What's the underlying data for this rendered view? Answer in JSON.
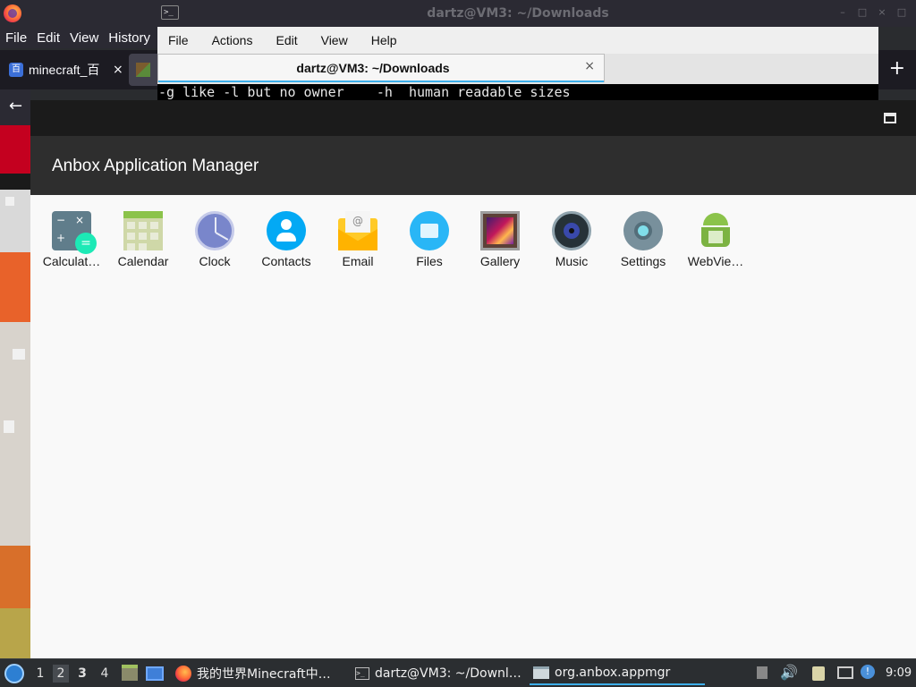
{
  "firefox": {
    "menu": [
      "File",
      "Edit",
      "View",
      "History"
    ],
    "tab1_label": "minecraft_百",
    "tab1_close": "×",
    "new_tab": "+",
    "back": "←",
    "tab1_favicon": "百"
  },
  "terminal": {
    "window_title": "dartz@VM3: ~/Downloads",
    "menu": [
      "File",
      "Actions",
      "Edit",
      "View",
      "Help"
    ],
    "tab_title": "dartz@VM3: ~/Downloads",
    "tab_close": "×",
    "output_line": "-g like -l but no owner    -h  human readable sizes",
    "window_buttons": [
      "–",
      "□",
      "×",
      "□"
    ]
  },
  "anbox": {
    "title": "Anbox Application Manager",
    "apps": [
      {
        "label": "Calculat…",
        "icon": "calculator-icon"
      },
      {
        "label": "Calendar",
        "icon": "calendar-icon"
      },
      {
        "label": "Clock",
        "icon": "clock-icon"
      },
      {
        "label": "Contacts",
        "icon": "contacts-icon"
      },
      {
        "label": "Email",
        "icon": "email-icon"
      },
      {
        "label": "Files",
        "icon": "files-icon"
      },
      {
        "label": "Gallery",
        "icon": "gallery-icon"
      },
      {
        "label": "Music",
        "icon": "music-icon"
      },
      {
        "label": "Settings",
        "icon": "settings-icon"
      },
      {
        "label": "WebVie…",
        "icon": "webview-icon"
      }
    ],
    "calc_glyphs": [
      "−",
      "×",
      "+",
      "="
    ],
    "email_glyph": "@"
  },
  "taskbar": {
    "desktops": [
      "1",
      "2",
      "3",
      "4"
    ],
    "tasks": [
      {
        "label": "我的世界Minecraft中…",
        "icon": "firefox-icon"
      },
      {
        "label": "dartz@VM3: ~/Downl…",
        "icon": "terminal-icon"
      },
      {
        "label": "org.anbox.appmgr",
        "icon": "window-icon"
      }
    ],
    "volume_glyph": "🔊",
    "update_glyph": "!",
    "clock": "9:09"
  }
}
